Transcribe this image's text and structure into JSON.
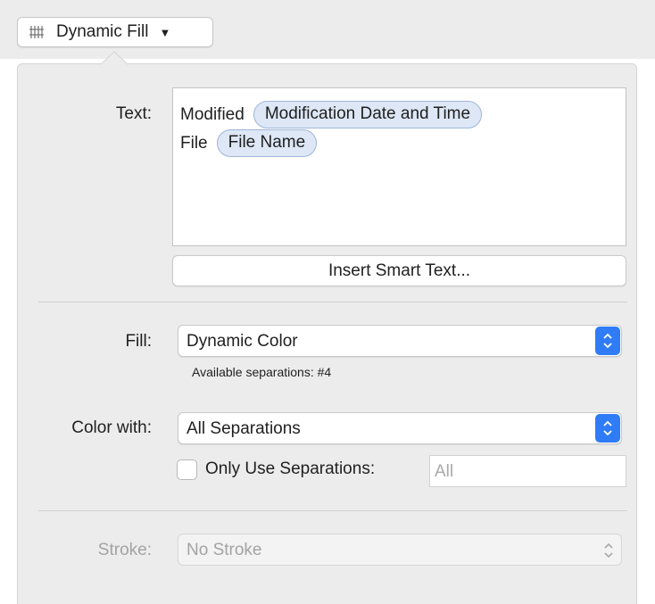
{
  "toolbar": {
    "dynamic_fill_label": "Dynamic Fill",
    "dynamic_fill_icon": "dynamic-fill-icon"
  },
  "text_section": {
    "label": "Text:",
    "lines": [
      {
        "prefix": "Modified",
        "token": "Modification Date and Time"
      },
      {
        "prefix": "File",
        "token": "File Name"
      }
    ],
    "insert_button": "Insert Smart Text..."
  },
  "fill_section": {
    "label": "Fill:",
    "value": "Dynamic Color",
    "note": "Available separations: #4"
  },
  "color_section": {
    "label": "Color with:",
    "value": "All Separations",
    "only_use_label": "Only Use Separations:",
    "only_use_checked": false,
    "separations_placeholder": "All"
  },
  "stroke_section": {
    "label": "Stroke:",
    "value": "No Stroke",
    "enabled": false
  },
  "colors": {
    "accent": "#2f7cf6",
    "token_fill": "#dde7f6",
    "token_border": "#9fb5d8",
    "panel_bg": "#ececec"
  }
}
